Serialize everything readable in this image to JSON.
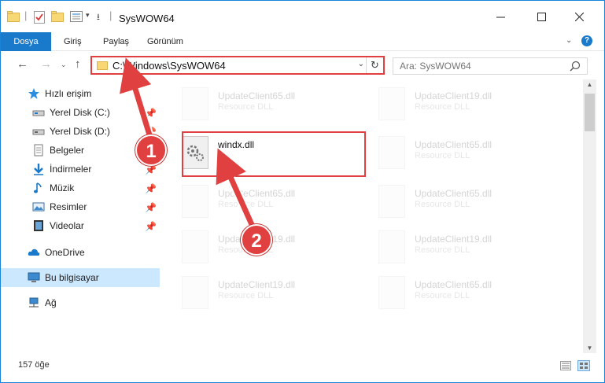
{
  "window": {
    "title": "SysWOW64"
  },
  "ribbon": {
    "tabs": [
      "Dosya",
      "Giriş",
      "Paylaş",
      "Görünüm"
    ]
  },
  "address": {
    "path": "C:\\Windows\\SysWOW64"
  },
  "search": {
    "placeholder": "Ara: SysWOW64"
  },
  "sidebar": {
    "items": [
      {
        "label": "Hızlı erişim",
        "icon": "star-icon",
        "pinned": false
      },
      {
        "label": "Yerel Disk (C:)",
        "icon": "drive-icon",
        "pinned": true
      },
      {
        "label": "Yerel Disk (D:)",
        "icon": "drive-icon",
        "pinned": true
      },
      {
        "label": "Belgeler",
        "icon": "document-icon",
        "pinned": true
      },
      {
        "label": "İndirmeler",
        "icon": "download-icon",
        "pinned": true
      },
      {
        "label": "Müzik",
        "icon": "music-icon",
        "pinned": true
      },
      {
        "label": "Resimler",
        "icon": "pictures-icon",
        "pinned": true
      },
      {
        "label": "Videolar",
        "icon": "video-icon",
        "pinned": true
      },
      {
        "label": "OneDrive",
        "icon": "cloud-icon",
        "pinned": false
      },
      {
        "label": "Bu bilgisayar",
        "icon": "computer-icon",
        "pinned": false,
        "selected": true
      },
      {
        "label": "Ağ",
        "icon": "network-icon",
        "pinned": false
      }
    ]
  },
  "files": [
    {
      "name": "UpdateClient65.dll",
      "type": "Resource DLL",
      "faded": true
    },
    {
      "name": "UpdateClient19.dll",
      "type": "Resource DLL",
      "faded": true
    },
    {
      "name": "windx.dll",
      "type": "",
      "faded": false
    },
    {
      "name": "UpdateClient65.dll",
      "type": "Resource DLL",
      "faded": true
    },
    {
      "name": "UpdateClient65.dll",
      "type": "Resource DLL",
      "faded": true
    },
    {
      "name": "UpdateClient65.dll",
      "type": "Resource DLL",
      "faded": true
    },
    {
      "name": "UpdateClient19.dll",
      "type": "Resource DLL",
      "faded": true
    },
    {
      "name": "UpdateClient19.dll",
      "type": "Resource DLL",
      "faded": true
    },
    {
      "name": "UpdateClient19.dll",
      "type": "Resource DLL",
      "faded": true
    },
    {
      "name": "UpdateClient65.dll",
      "type": "Resource DLL",
      "faded": true
    }
  ],
  "status": {
    "count": "157 öğe"
  },
  "annotations": {
    "step1": "1",
    "step2": "2"
  },
  "colors": {
    "accent": "#1979ca",
    "annotation": "#e04040",
    "selected": "#cce8ff"
  }
}
